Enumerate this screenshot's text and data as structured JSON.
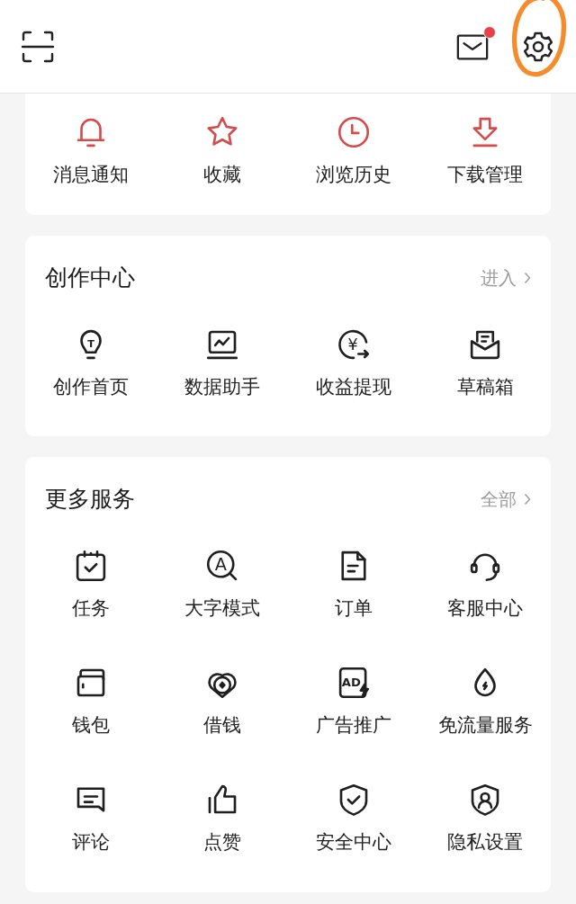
{
  "header": {
    "scan": {
      "kind": "scan"
    },
    "mail": {
      "unread": true
    },
    "settings": {
      "highlighted": true
    }
  },
  "quick_actions": [
    {
      "kind": "bell",
      "label": "消息通知"
    },
    {
      "kind": "star",
      "label": "收藏"
    },
    {
      "kind": "clock",
      "label": "浏览历史"
    },
    {
      "kind": "download",
      "label": "下载管理"
    }
  ],
  "creator_center": {
    "title": "创作中心",
    "link": "进入",
    "items": [
      {
        "kind": "bulb",
        "icon_text": "T",
        "label": "创作首页"
      },
      {
        "kind": "chart",
        "label": "数据助手"
      },
      {
        "kind": "coin",
        "icon_text": "¥",
        "label": "收益提现"
      },
      {
        "kind": "drafts",
        "label": "草稿箱"
      }
    ]
  },
  "more_services": {
    "title": "更多服务",
    "link": "全部",
    "items": [
      {
        "kind": "calendar",
        "label": "任务"
      },
      {
        "kind": "font",
        "icon_text": "A",
        "label": "大字模式"
      },
      {
        "kind": "document",
        "label": "订单"
      },
      {
        "kind": "headset",
        "label": "客服中心"
      },
      {
        "kind": "wallet",
        "label": "钱包"
      },
      {
        "kind": "rings",
        "label": "借钱"
      },
      {
        "kind": "ad",
        "icon_text": "AD",
        "label": "广告推广"
      },
      {
        "kind": "drop",
        "label": "免流量服务"
      },
      {
        "kind": "comment",
        "label": "评论"
      },
      {
        "kind": "thumb",
        "label": "点赞"
      },
      {
        "kind": "shield",
        "label": "安全中心"
      },
      {
        "kind": "privacy",
        "label": "隐私设置"
      }
    ]
  }
}
